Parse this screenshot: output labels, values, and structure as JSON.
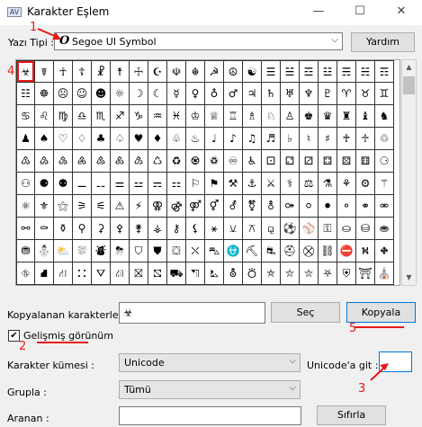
{
  "window": {
    "title": "Karakter Eşlem",
    "app_icon_text": "AV",
    "minimize": "—",
    "maximize": "☐",
    "close": "✕"
  },
  "font_row": {
    "label": "Yazı Tipi :",
    "font_icon": "O",
    "value": "Segoe UI Symbol",
    "help_button": "Yardım"
  },
  "grid": {
    "selected_index": 0,
    "rows": [
      [
        "☣",
        "☤",
        "☥",
        "☦",
        "☧",
        "☨",
        "☩",
        "☪",
        "☫",
        "☬",
        "☭",
        "☮",
        "☯",
        "☰",
        "☱",
        "☲",
        "☳",
        "☴",
        "☵",
        "☶"
      ],
      [
        "☷",
        "☸",
        "☹",
        "☺",
        "☻",
        "☼",
        "☽",
        "☾",
        "☿",
        "♀",
        "♁",
        "♂",
        "♃",
        "♄",
        "♅",
        "♆",
        "♇",
        "♈",
        "♉",
        "♊"
      ],
      [
        "♋",
        "♌",
        "♍",
        "♎",
        "♏",
        "♐",
        "♑",
        "♒",
        "♓",
        "♔",
        "♕",
        "♖",
        "♗",
        "♘",
        "♙",
        "♚",
        "♛",
        "♜",
        "♝",
        "♞"
      ],
      [
        "♟",
        "♠",
        "♡",
        "♢",
        "♣",
        "♤",
        "♥",
        "♦",
        "♧",
        "♨",
        "♩",
        "♪",
        "♫",
        "♬",
        "♭",
        "♮",
        "♯",
        "♰",
        "♱",
        "♲"
      ],
      [
        "♳",
        "♴",
        "♵",
        "♶",
        "♷",
        "♸",
        "♹",
        "♺",
        "♻",
        "♼",
        "♽",
        "♾",
        "♿",
        "⚀",
        "⚁",
        "⚂",
        "⚃",
        "⚄",
        "⚅",
        "⚆"
      ],
      [
        "⚇",
        "⚈",
        "⚉",
        "⚊",
        "⚋",
        "⚌",
        "⚍",
        "⚎",
        "⚏",
        "⚐",
        "⚑",
        "⚒",
        "⚓",
        "⚔",
        "⚕",
        "⚖",
        "⚗",
        "⚘",
        "⚙",
        "⚚"
      ],
      [
        "⚛",
        "⚜",
        "⚝",
        "⚞",
        "⚟",
        "⚠",
        "⚡",
        "⚢",
        "⚣",
        "⚤",
        "⚥",
        "⚦",
        "⚧",
        "⚨",
        "⚩",
        "⚪",
        "⚫",
        "⚬",
        "⚭",
        "⚮"
      ],
      [
        "⚯",
        "⚰",
        "⚱",
        "⚲",
        "⚳",
        "⚴",
        "⚵",
        "⚶",
        "⚷",
        "⚸",
        "⚹",
        "⚺",
        "⚻",
        "⚼",
        "⚽",
        "⚾",
        "⚿",
        "⛀",
        "⛁",
        "⛂"
      ],
      [
        "⛃",
        "⛄",
        "⛅",
        "⛆",
        "⛇",
        "⛈",
        "⛉",
        "⛊",
        "⛋",
        "⛌",
        "⛍",
        "⛎",
        "⛏",
        "⛐",
        "⛑",
        "⛒",
        "⛓",
        "⛔",
        "⛕",
        "⛖"
      ],
      [
        "⛗",
        "⛘",
        "⛙",
        "⛚",
        "⛛",
        "⛜",
        "⛝",
        "⛞",
        "⛟",
        "⛠",
        "⛡",
        "⛢",
        "⛣",
        "⛤",
        "⛥",
        "⛦",
        "⛧",
        "⛨",
        "⛩",
        "⛪"
      ]
    ]
  },
  "copy_row": {
    "label": "Kopyalanan karakterler :",
    "value": "☣",
    "select_button": "Seç",
    "copy_button": "Kopyala"
  },
  "advanced": {
    "label": "Gelişmiş görünüm",
    "checked": true,
    "check_mark": "✔"
  },
  "charset": {
    "label": "Karakter kümesi :",
    "value": "Unicode",
    "goto_label": "Unicode'a git :",
    "goto_value": ""
  },
  "group": {
    "label": "Grupla :",
    "value": "Tümü"
  },
  "search": {
    "label": "Aranan :",
    "value": "",
    "reset_button": "Sıfırla"
  },
  "annotations": {
    "n1": "1",
    "n2": "2",
    "n3": "3",
    "n4": "4",
    "n5": "5",
    "color": "#e81818"
  },
  "scrollbar": {
    "up": "▲",
    "down": "▼"
  }
}
